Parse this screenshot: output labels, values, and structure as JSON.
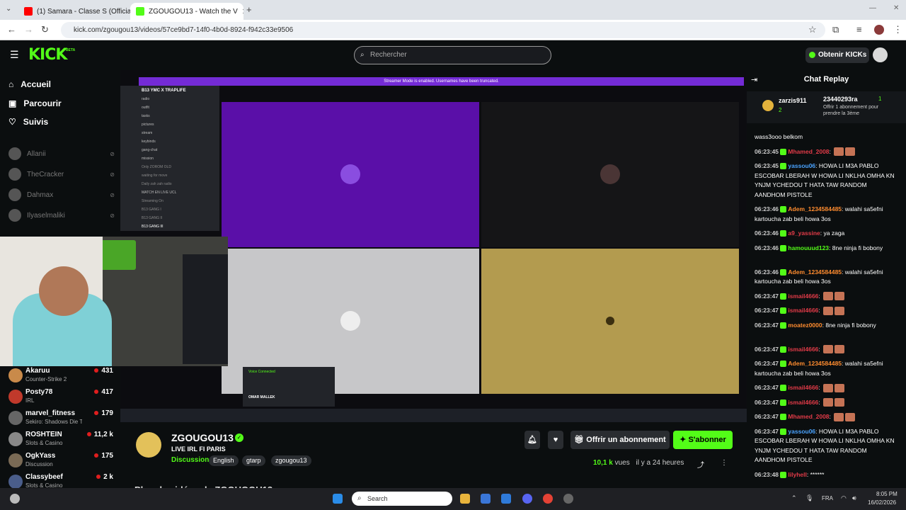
{
  "browser": {
    "tabs": [
      {
        "title": "(1) Samara - Classe S (Official M",
        "active": false
      },
      {
        "title": "ZGOUGOU13 - Watch the V",
        "active": true
      }
    ],
    "url": "kick.com/zgougou13/videos/57ce9bd7-14f0-4b0d-8924-f942c33e9506"
  },
  "header": {
    "logo": "KICK",
    "beta": "BETA",
    "search_placeholder": "Rechercher",
    "get_kicks": "Obtenir KICKs"
  },
  "sidebar": {
    "nav": [
      "Accueil",
      "Parcourir",
      "Suivis"
    ],
    "followed": [
      "Allanii",
      "TheCracker",
      "Dahmax",
      "Ilyaselmaliki"
    ],
    "recommended": [
      {
        "name": "Akaruu",
        "category": "Counter-Strike 2",
        "viewers": "431"
      },
      {
        "name": "Posty78",
        "category": "IRL",
        "viewers": "417"
      },
      {
        "name": "marvel_fitness",
        "category": "Sekiro: Shadows Die T...",
        "viewers": "179"
      },
      {
        "name": "ROSHTEIN",
        "category": "Slots & Casino",
        "viewers": "11,2 k"
      },
      {
        "name": "OgkYass",
        "category": "Discussion",
        "viewers": "175"
      },
      {
        "name": "Classybeef",
        "category": "Slots & Casino",
        "viewers": "2 k"
      }
    ]
  },
  "video": {
    "top_banner": "Streamer Mode is enabled. Usernames have been truncated.",
    "server_name": "B13 YMC X TRAPLIFE",
    "channels": [
      "radio",
      "outfit",
      "tasks",
      "pictures",
      "stream",
      "keybinds",
      "gang-chat",
      "mission",
      "Only ZOROM OLD",
      "waiting for move",
      "Daily zah zah radio",
      "MATCH EN LIVE UCL",
      "Streaming On",
      "B13 GANG I",
      "B13 GANG II",
      "B13 GANG III"
    ],
    "overlay_user": "OMAR MALLEK",
    "overlay_status": "Voice Connected"
  },
  "stream": {
    "streamer": "ZGOUGOU13",
    "title": "LIVE IRL FI PARIS",
    "category": "Discussion",
    "tags": [
      "English",
      "gtarp",
      "zgougou13"
    ],
    "subscribe_gift": "Offrir un abonnement",
    "subscribe": "S'abonner",
    "views": "10,1 k",
    "views_label": "vues",
    "time_ago": "il y a 24 heures",
    "more_videos": "Plus de vidéos de ZGOUGOU13"
  },
  "chat": {
    "title": "Chat Replay",
    "pinned": {
      "user1": "zarzis911",
      "user1_count": "2",
      "user2": "23440293ra",
      "user2_count": "1",
      "text": "Offrir 1 abonnement pour prendre la 3ème"
    },
    "messages": [
      {
        "time": "",
        "user": "",
        "color": "#ffffff",
        "text": "wass3ooo belkom"
      },
      {
        "time": "06:23:45",
        "user": "Mhamed_2008",
        "color": "#e23b48",
        "text": ""
      },
      {
        "time": "06:23:45",
        "user": "yassou06",
        "color": "#4aa3ff",
        "text": "HOWA LI M3A PABLO ESCOBAR LBERAH W HOWA LI NKLHA OMHA KN YNJM YCHEDOU T HATA TAW RANDOM AANDHOM PISTOLE"
      },
      {
        "time": "06:23:46",
        "user": "Adem_1234584485",
        "color": "#ff8c2f",
        "text": "walahi sa5efni kartoucha zab beli howa 3os"
      },
      {
        "time": "06:23:46",
        "user": "a9_yassine",
        "color": "#e23b48",
        "text": "ya zaga"
      },
      {
        "time": "06:23:46",
        "user": "hamouuud123",
        "color": "#53fc18",
        "text": "8ne ninja fi bobony"
      },
      {
        "time": "06:23:46",
        "user": "Adem_1234584485",
        "color": "#ff8c2f",
        "text": "walahi sa5efni kartoucha zab beli howa 3os"
      },
      {
        "time": "06:23:47",
        "user": "ismail4666",
        "color": "#e23b48",
        "text": ""
      },
      {
        "time": "06:23:47",
        "user": "ismail4666",
        "color": "#e23b48",
        "text": ""
      },
      {
        "time": "06:23:47",
        "user": "moatez0000",
        "color": "#ff8c2f",
        "text": "8ne ninja fi bobony"
      },
      {
        "time": "06:23:47",
        "user": "ismail4666",
        "color": "#e23b48",
        "text": ""
      },
      {
        "time": "06:23:47",
        "user": "Adem_1234584485",
        "color": "#ff8c2f",
        "text": "walahi sa5efni kartoucha zab beli howa 3os"
      },
      {
        "time": "06:23:47",
        "user": "ismail4666",
        "color": "#e23b48",
        "text": ""
      },
      {
        "time": "06:23:47",
        "user": "ismail4666",
        "color": "#e23b48",
        "text": ""
      },
      {
        "time": "06:23:47",
        "user": "Mhamed_2008",
        "color": "#e23b48",
        "text": ""
      },
      {
        "time": "06:23:47",
        "user": "yassou06",
        "color": "#4aa3ff",
        "text": "HOWA LI M3A PABLO ESCOBAR LBERAH W HOWA LI NKLHA OMHA KN YNJM YCHEDOU T HATA TAW RANDOM AANDHOM PISTOLE"
      },
      {
        "time": "06:23:48",
        "user": "lilyhell",
        "color": "#e23b48",
        "text": "******"
      }
    ]
  },
  "taskbar": {
    "search": "Search",
    "lang": "FRA",
    "time": "8:05 PM",
    "date": "16/02/2026"
  },
  "colors": {
    "accent": "#53fc18",
    "bg": "#0b0e0f",
    "purple": "#5a0fa8",
    "gold": "#b39b4f"
  }
}
